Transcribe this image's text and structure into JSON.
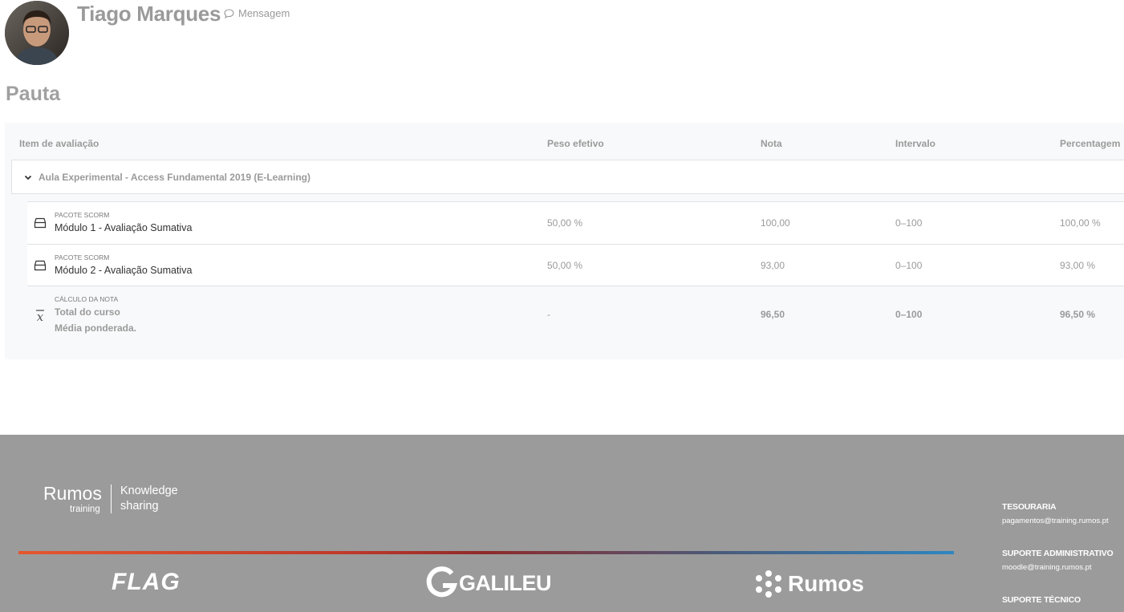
{
  "user": {
    "name": "Tiago Marques",
    "message_label": "Mensagem"
  },
  "page": {
    "title": "Pauta"
  },
  "table": {
    "headers": {
      "item": "Item de avaliação",
      "weight": "Peso efetivo",
      "grade": "Nota",
      "range": "Intervalo",
      "percentage": "Percentagem"
    },
    "category": "Aula Experimental - Access Fundamental 2019 (E-Learning)",
    "items": [
      {
        "type": "PACOTE SCORM",
        "name": "Módulo 1 - Avaliação Sumativa",
        "weight": "50,00 %",
        "grade": "100,00",
        "range": "0–100",
        "percentage": "100,00 %"
      },
      {
        "type": "PACOTE SCORM",
        "name": "Módulo 2 - Avaliação Sumativa",
        "weight": "50,00 %",
        "grade": "93,00",
        "range": "0–100",
        "percentage": "93,00 %"
      }
    ],
    "total": {
      "type": "CÁLCULO DA NOTA",
      "name": "Total do curso",
      "subname": "Média ponderada.",
      "weight": "-",
      "grade": "96,50",
      "range": "0–100",
      "percentage": "96,50 %"
    }
  },
  "footer": {
    "brand": {
      "word": "Rumos",
      "sub": "training",
      "tag1": "Knowledge",
      "tag2": "sharing"
    },
    "partners": {
      "flag": "FLAG",
      "galileu": "GALILEU",
      "rumos": "Rumos"
    },
    "contacts": [
      {
        "label": "TESOURARIA",
        "value": "pagamentos@training.rumos.pt"
      },
      {
        "label": "SUPORTE ADMINISTRATIVO",
        "value": "moodle@training.rumos.pt"
      },
      {
        "label": "SUPORTE TÉCNICO",
        "value": ""
      }
    ]
  }
}
